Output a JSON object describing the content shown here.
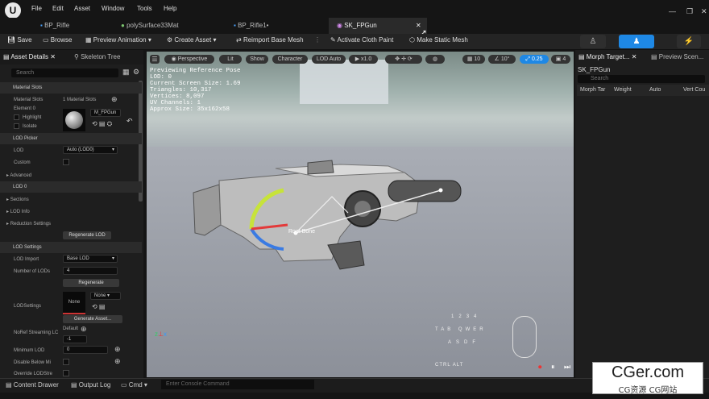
{
  "app": {
    "logo_glyph": "U",
    "menu": [
      "File",
      "Edit",
      "Asset",
      "Window",
      "Tools",
      "Help"
    ]
  },
  "tabs": [
    {
      "label": "BP_Rifle"
    },
    {
      "label": "polySurface33Mat"
    },
    {
      "label": "BP_Rifle1•"
    },
    {
      "label": "SK_FPGun"
    }
  ],
  "toolbar": {
    "save": "Save",
    "browse": "Browse",
    "preview_animation": "Preview Animation",
    "create_asset": "Create Asset",
    "reimport": "Reimport Base Mesh",
    "cloth": "Activate Cloth Paint",
    "static_mesh": "Make Static Mesh"
  },
  "left": {
    "tab_details": "Asset Details",
    "tab_skeleton": "Skeleton Tree",
    "search_placeholder": "Search",
    "sections": {
      "material_slots": "Material Slots",
      "lod_picker": "LOD Picker",
      "lod0": "LOD 0",
      "lod_settings": "LOD Settings"
    },
    "rows": {
      "material_slots_label": "Material Slots",
      "material_slots_value": "1 Material Slots",
      "element0": "Element 0",
      "highlight": "Highlight",
      "isolate": "Isolate",
      "material_name": "M_FPGun",
      "lod": "LOD",
      "lod_value": "Auto (LOD0)",
      "custom": "Custom",
      "advanced": "Advanced",
      "sections": "Sections",
      "lod_info": "LOD Info",
      "reduction": "Reduction Settings",
      "regen_lod": "Regenerate LOD",
      "lod_import": "LOD Import",
      "lod_import_value": "Base LOD",
      "num_lods": "Number of LODs",
      "num_lods_value": "4",
      "regenerate": "Regenerate",
      "lodsettings": "LODSettings",
      "none1": "None",
      "none2": "None",
      "generate": "Generate Asset...",
      "noref": "NoRef Streaming LC",
      "default": "Default",
      "noref_value": "-1",
      "min_lod": "Minimum LOD",
      "min_lod_value": "0",
      "disable_below": "Disable Below Mi",
      "override": "Override LODStre"
    }
  },
  "viewport": {
    "perspective": "Perspective",
    "lit": "Lit",
    "show": "Show",
    "character": "Character",
    "lod_auto": "LOD Auto",
    "speed": "x1.0",
    "grid": "10",
    "angle": "10°",
    "scale": "0.25",
    "cam": "4",
    "stats": [
      "Previewing Reference Pose",
      "LOD: 0",
      "Current Screen Size: 1.69",
      "Triangles: 10,317",
      "Vertices: 8,097",
      "UV Channels: 1",
      "Approx Size: 35x162x58"
    ],
    "bone": "Root Bone",
    "keys": [
      "1",
      "2",
      "3",
      "4",
      "TAB",
      "Q",
      "W",
      "E",
      "R",
      "A",
      "S",
      "D",
      "F",
      "CTRL",
      "ALT"
    ]
  },
  "right": {
    "tab_morph": "Morph Target...",
    "tab_preview": "Preview Scen...",
    "asset": "SK_FPGun",
    "search_placeholder": "Search",
    "cols": [
      "Morph Tar",
      "Weight",
      "Auto",
      "Vert Cou"
    ]
  },
  "status": {
    "drawer": "Content Drawer",
    "output": "Output Log",
    "cmd": "Cmd",
    "console_placeholder": "Enter Console Command"
  },
  "watermark": {
    "title": "CGer.com",
    "sub": "CG资源 CG网站"
  },
  "colors": {
    "accent": "#1e88e5",
    "viewport_bg": "#8a8f98"
  }
}
